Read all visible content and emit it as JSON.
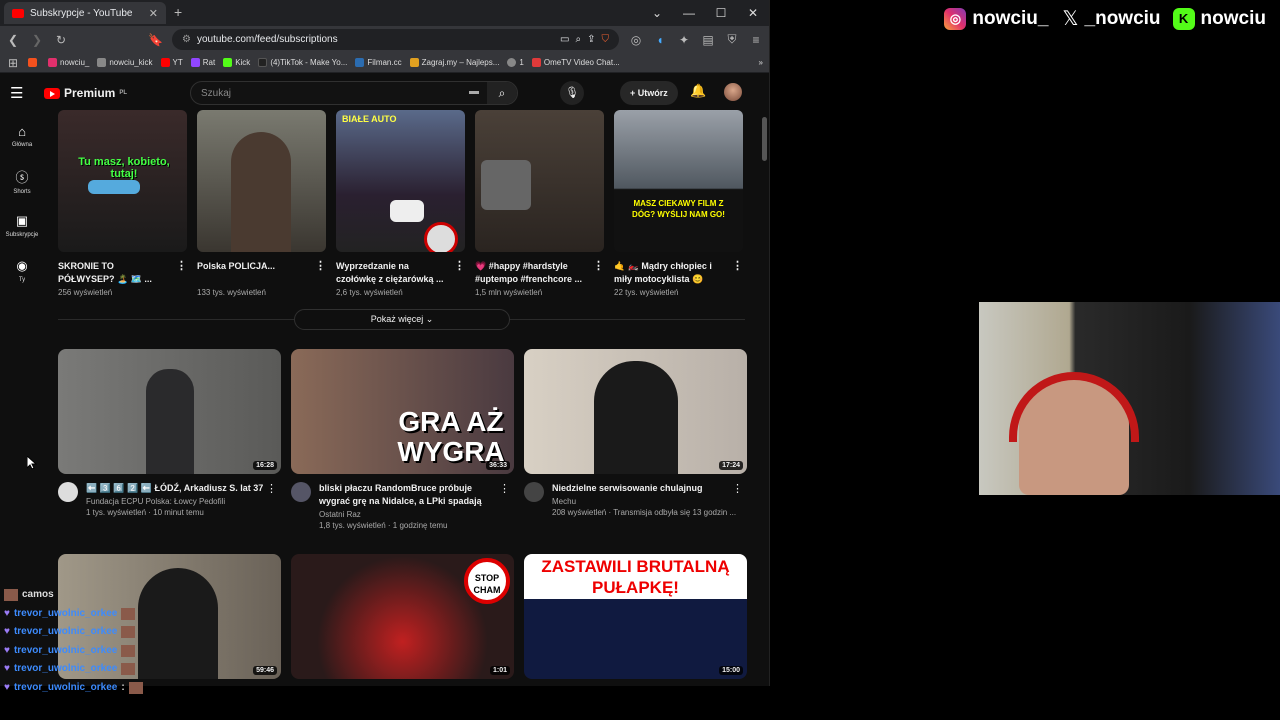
{
  "browser": {
    "tab_title": "Subskrypcje - YouTube",
    "url": "youtube.com/feed/subscriptions",
    "bookmarks": [
      {
        "label": "",
        "color": "#f4511e"
      },
      {
        "label": "nowciu_",
        "color": "#e1306c"
      },
      {
        "label": "nowciu_kick",
        "color": "#888888"
      },
      {
        "label": "YT",
        "color": "#ff0000"
      },
      {
        "label": "Rat",
        "color": "#9146ff"
      },
      {
        "label": "Kick",
        "color": "#53fc18"
      },
      {
        "label": "(4)TikTok - Make Yo...",
        "color": "#222222"
      },
      {
        "label": "Filman.cc",
        "color": "#2b6cb0"
      },
      {
        "label": "Zagraj.my – Najleps...",
        "color": "#e0a020"
      },
      {
        "label": "1",
        "color": "#888888"
      },
      {
        "label": "OmeTV Video Chat...",
        "color": "#e03a3a"
      }
    ]
  },
  "youtube": {
    "logo": "Premium",
    "logo_region": "PL",
    "search_placeholder": "Szukaj",
    "create_label": "Utwórz",
    "sidebar": [
      {
        "label": "Główna",
        "icon": "home-icon"
      },
      {
        "label": "Shorts",
        "icon": "shorts-icon"
      },
      {
        "label": "Subskrypcje",
        "icon": "subscriptions-icon"
      },
      {
        "label": "Ty",
        "icon": "user-icon"
      }
    ],
    "shorts": [
      {
        "title": "SKRONIE TO PÓŁWYSEP? 🏝️ 🗺️ ...",
        "views": "256 wyświetleń",
        "overlay": "Tu masz, kobieto, tutaj!",
        "bg": "#2a2a2a"
      },
      {
        "title": "Polska POLICJA...",
        "views": "133 tys. wyświetleń",
        "overlay": "",
        "bg": "#4a4640"
      },
      {
        "title": "Wyprzedzanie na czołówkę z ciężarówką ...",
        "views": "2,6 tys. wyświetleń",
        "overlay": "BIAŁE AUTO",
        "bg": "#1c2a3a"
      },
      {
        "title": "💗 #happy #hardstyle #uptempo #frenchcore ...",
        "views": "1,5 mln wyświetleń",
        "overlay": "",
        "bg": "#3a3028"
      },
      {
        "title": "🤙 🏍️ Mądry chłopiec i miły motocyklista 😊",
        "views": "22 tys. wyświetleń",
        "overlay": "MASZ CIEKAWY FILM Z DÓG? WYŚLIJ NAM GO!",
        "bg": "#5a6068"
      }
    ],
    "show_more": "Pokaż więcej",
    "videos_row1": [
      {
        "title": "⬅️ 3️⃣ 6️⃣ 2️⃣ ⬅️ ŁÓDŹ, Arkadiusz S. lat 37",
        "channel": "Fundacja ECPU Polska: Łowcy Pedofili",
        "stats": "1 tys. wyświetleń · 10 minut temu",
        "duration": "16:28",
        "overlay": "",
        "bg": "#6a6a6a"
      },
      {
        "title": "bliski płaczu RandomBruce próbuje wygrać grę na Nidalce, a LPki spadają",
        "channel": "Ostatni Raz",
        "stats": "1,8 tys. wyświetleń · 1 godzinę temu",
        "duration": "36:33",
        "overlay": "GRA AŻ WYGRA",
        "bg": "#6b5a50"
      },
      {
        "title": "Niedzielne serwisowanie chulajnug",
        "channel": "Mechu",
        "stats": "208 wyświetleń · Transmisja odbyła się 13 godzin ...",
        "duration": "17:24",
        "overlay": "",
        "bg": "#b0a89e"
      }
    ],
    "videos_row2": [
      {
        "duration": "59:46",
        "overlay": "",
        "bg": "#8a8278"
      },
      {
        "duration": "1:01",
        "overlay": "STOP CHAM",
        "bg": "#3a2020"
      },
      {
        "duration": "15:00",
        "overlay": "ZASTAWILI BRUTALNĄ PUŁAPKĘ!",
        "bg": "#101a40"
      }
    ]
  },
  "overlay": {
    "social": [
      {
        "icon": "instagram-icon",
        "handle": "nowciu_"
      },
      {
        "icon": "x-icon",
        "handle": "_nowciu"
      },
      {
        "icon": "kick-icon",
        "handle": "nowciu"
      }
    ],
    "chat": [
      {
        "user": "camos",
        "message": ""
      },
      {
        "user": "trevor_uwolnic_orkee",
        "message": ""
      },
      {
        "user": "trevor_uwolnic_orkee",
        "message": ""
      },
      {
        "user": "trevor_uwolnic_orkee",
        "message": ""
      },
      {
        "user": "trevor_uwolnic_orkee",
        "message": ""
      },
      {
        "user": "trevor_uwolnic_orkee",
        "message": ":"
      }
    ]
  }
}
